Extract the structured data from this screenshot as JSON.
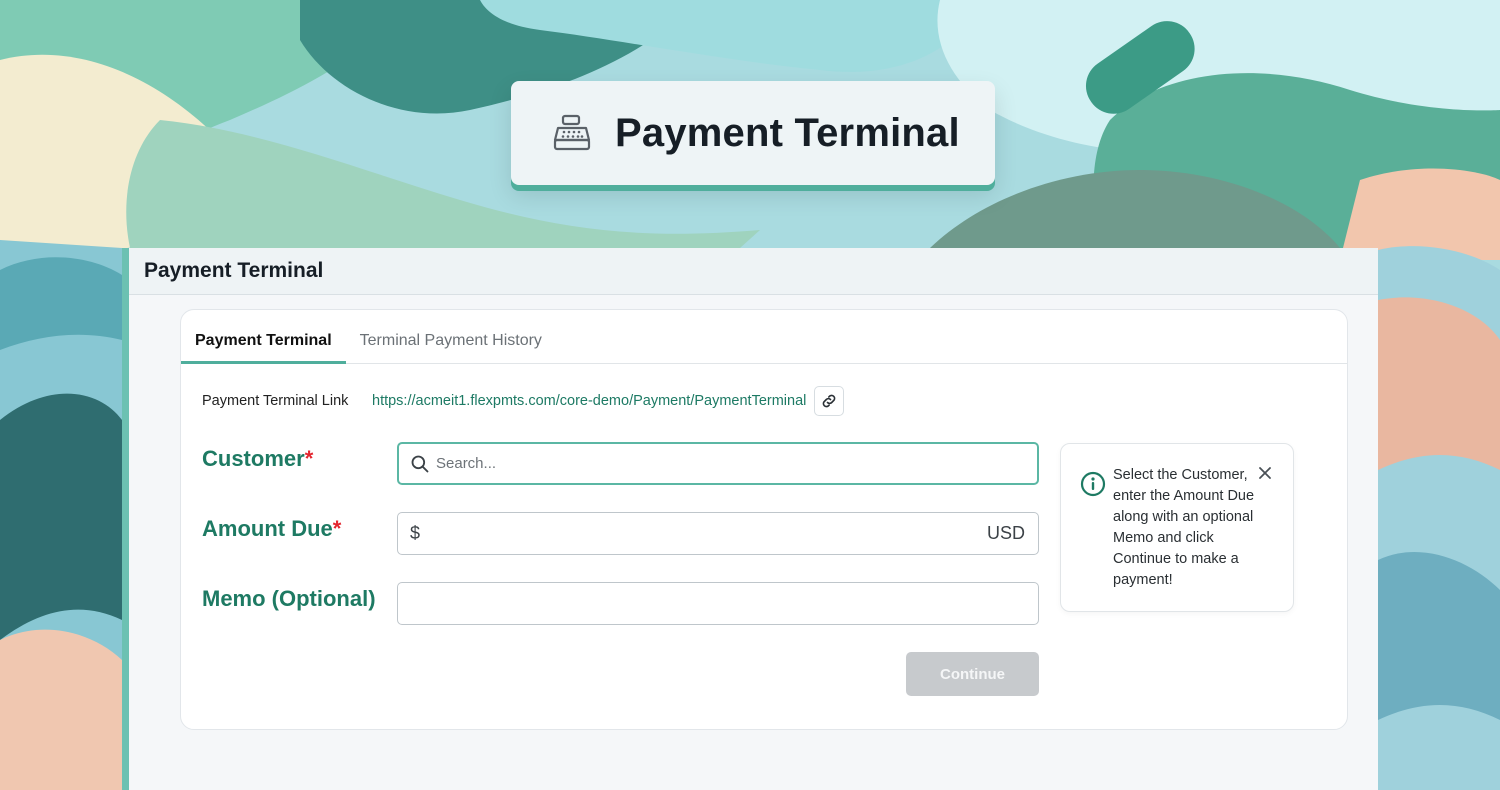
{
  "banner": {
    "title": "Payment Terminal",
    "icon": "cash-register-icon"
  },
  "panel": {
    "title": "Payment Terminal"
  },
  "tabs": [
    {
      "label": "Payment Terminal",
      "active": true
    },
    {
      "label": "Terminal Payment History",
      "active": false
    }
  ],
  "terminal_link": {
    "label": "Payment Terminal Link",
    "url": "https://acmeit1.flexpmts.com/core-demo/Payment/PaymentTerminal",
    "copy_icon": "link-icon"
  },
  "form": {
    "customer": {
      "label": "Customer",
      "required_mark": "*",
      "placeholder": "Search...",
      "value": ""
    },
    "amount_due": {
      "label": "Amount Due",
      "required_mark": "*",
      "prefix": "$",
      "suffix": "USD",
      "value": ""
    },
    "memo": {
      "label": "Memo (Optional)",
      "value": ""
    },
    "continue_label": "Continue"
  },
  "info": {
    "text": "Select the Customer, enter the Amount Due along with an optional Memo and click Continue to make a payment!",
    "icon": "info-icon",
    "close_icon": "close-icon"
  },
  "colors": {
    "accent": "#4fae9c",
    "label_green": "#1e7a63",
    "required_red": "#e3262f",
    "link_green": "#1d7a64",
    "disabled_button": "#c7cacd"
  }
}
